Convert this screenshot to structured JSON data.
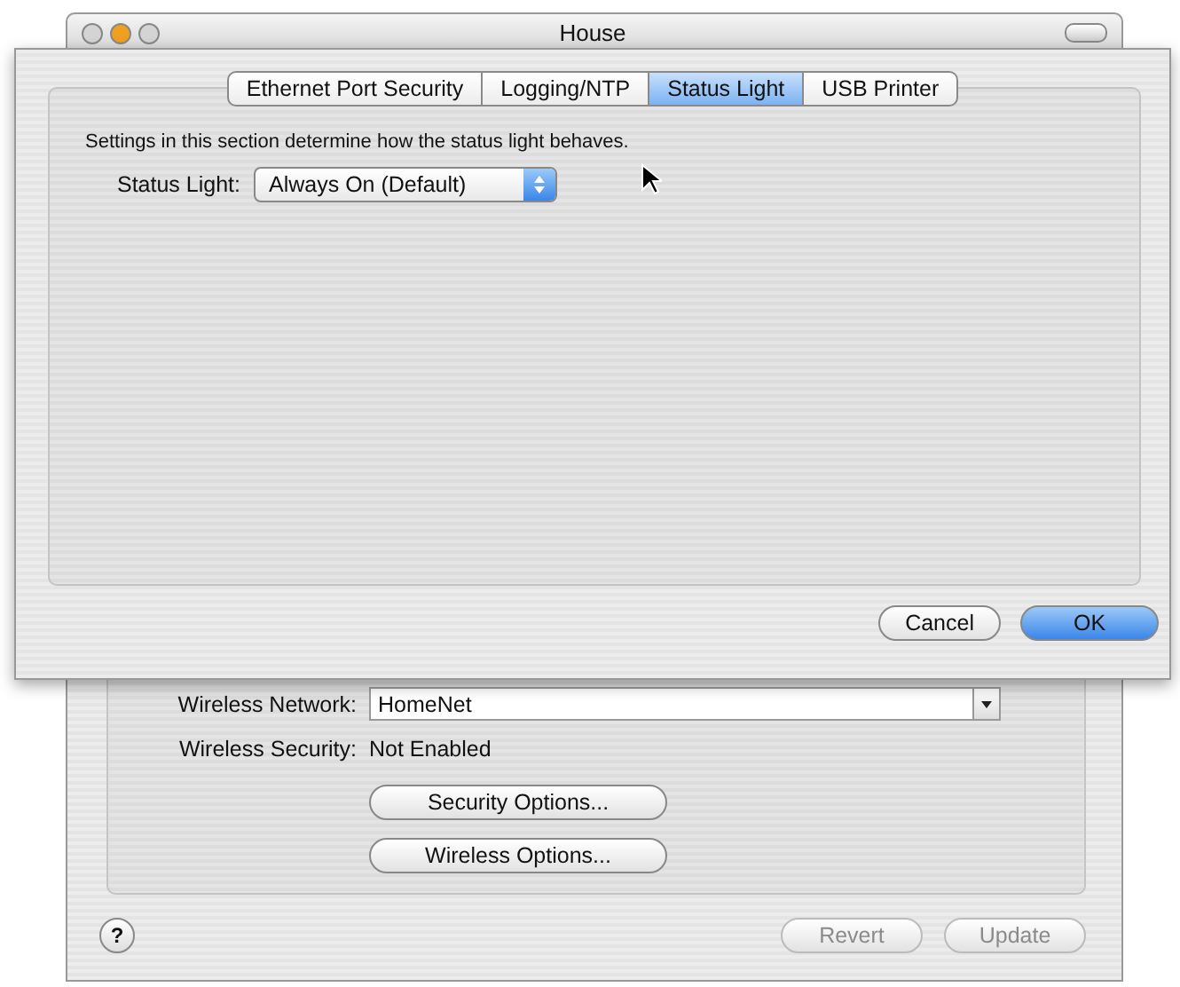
{
  "window": {
    "title": "House"
  },
  "airport_network": {
    "wireless_network": {
      "label": "Wireless Network:",
      "value": "HomeNet"
    },
    "wireless_security": {
      "label": "Wireless Security:",
      "value": "Not Enabled"
    },
    "buttons": [
      "Security Options...",
      "Wireless Options..."
    ]
  },
  "footer": {
    "help": "?",
    "buttons": [
      {
        "label": "Revert",
        "disabled": true
      },
      {
        "label": "Update",
        "disabled": true
      }
    ]
  },
  "sheet": {
    "tabs": [
      {
        "label": "Ethernet Port Security",
        "selected": false
      },
      {
        "label": "Logging/NTP",
        "selected": false
      },
      {
        "label": "Status Light",
        "selected": true
      },
      {
        "label": "USB Printer",
        "selected": false
      }
    ],
    "description": "Settings in this section determine how the status light behaves.",
    "status_light": {
      "label": "Status Light:",
      "value": "Always On (Default)"
    },
    "buttons": [
      {
        "label": "Cancel",
        "default": false
      },
      {
        "label": "OK",
        "default": true
      }
    ]
  }
}
